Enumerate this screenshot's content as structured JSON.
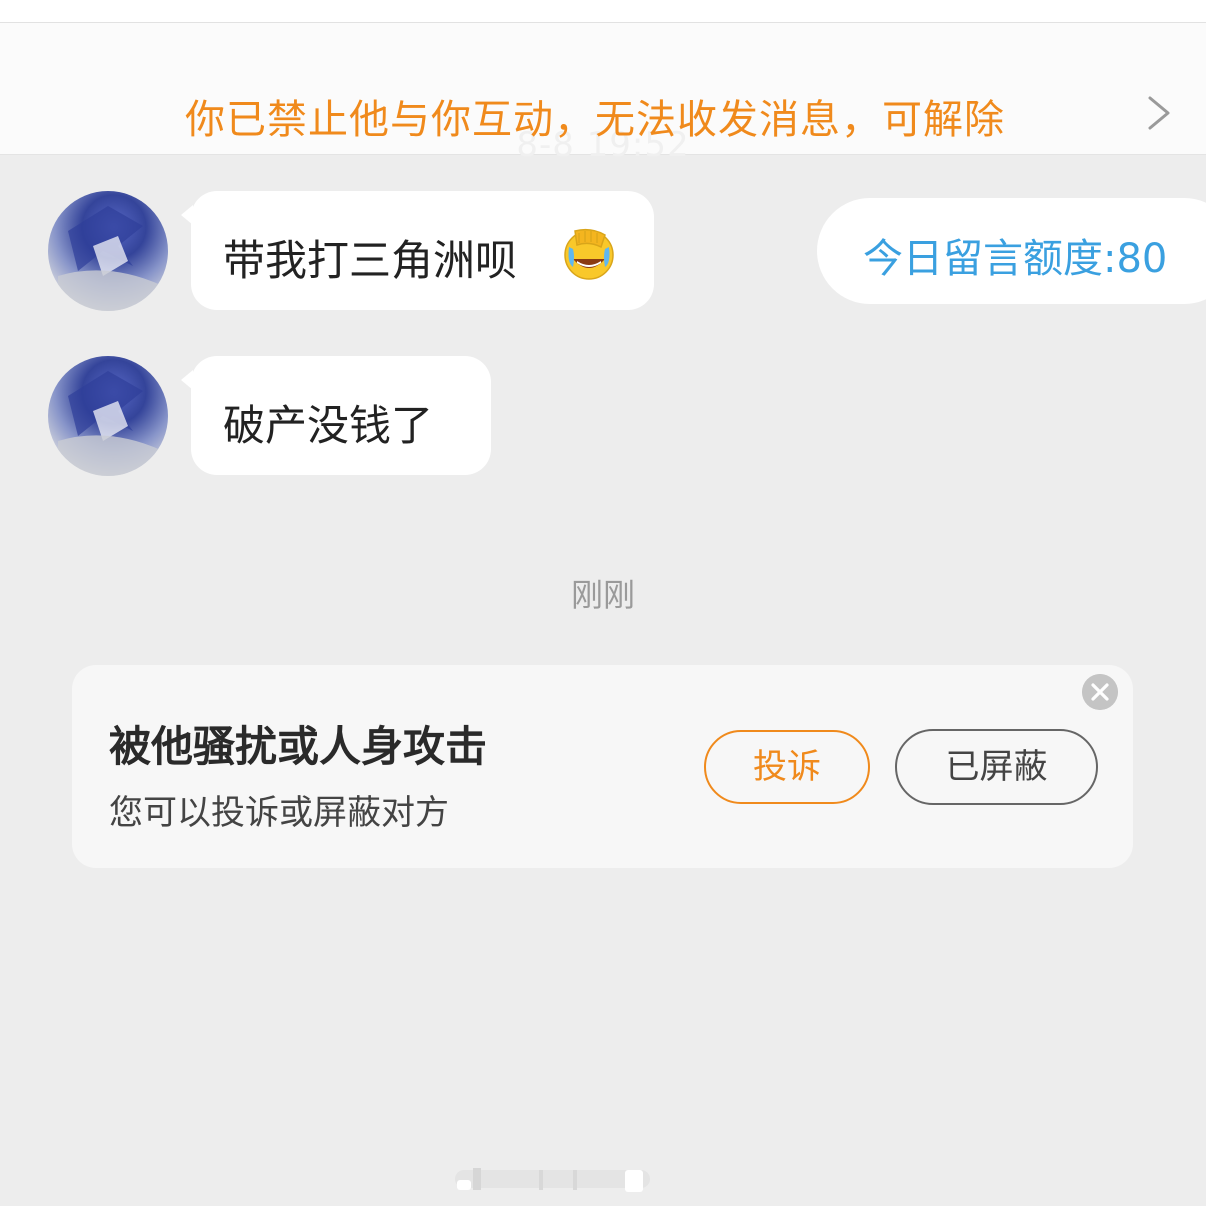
{
  "banner": {
    "ban_text": "你已禁止他与你互动，无法收发消息，可解除",
    "faded_time": "8-8 19:52"
  },
  "quota": {
    "text": "今日留言额度:80"
  },
  "messages": [
    {
      "text": "带我打三角洲呗",
      "emoji": "laughing-crying-facepalm-emoji"
    },
    {
      "text": "破产没钱了"
    }
  ],
  "timestamp": "刚刚",
  "report_card": {
    "title": "被他骚扰或人身攻击",
    "subtitle": "您可以投诉或屏蔽对方",
    "report_label": "投诉",
    "block_label": "已屏蔽"
  },
  "colors": {
    "accent_orange": "#f08a1c",
    "quota_blue": "#3aa0e0",
    "background": "#ededed"
  }
}
